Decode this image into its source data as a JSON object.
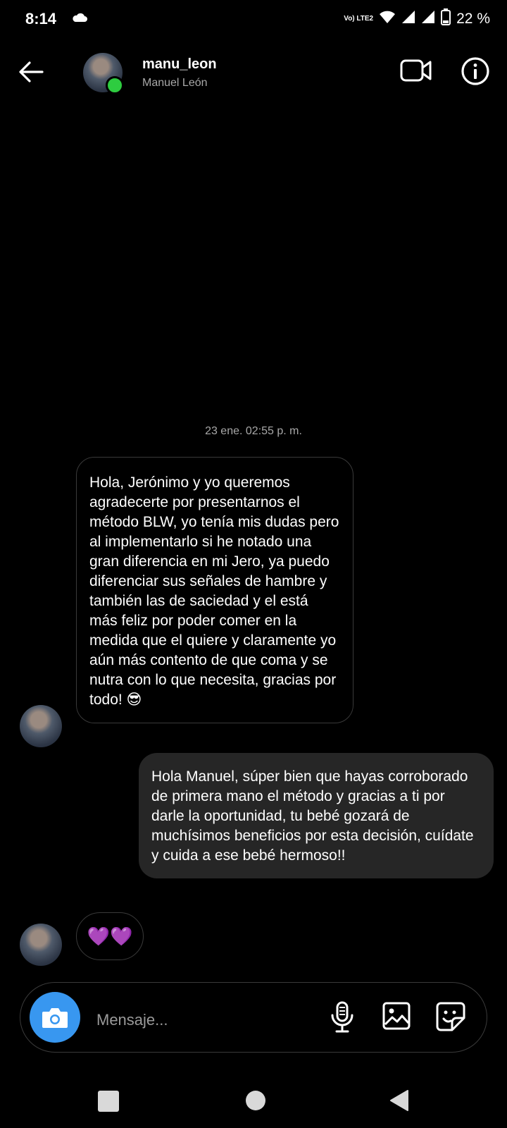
{
  "status_bar": {
    "time": "8:14",
    "network": "Vo) LTE2",
    "battery": "22 %"
  },
  "header": {
    "username": "manu_leon",
    "real_name": "Manuel León"
  },
  "conversation": {
    "timestamp": "23 ene. 02:55 p. m.",
    "incoming_message": "Hola, Jerónimo y yo queremos agradecerte por presentarnos el método BLW, yo tenía mis dudas pero al implementarlo si he notado una gran diferencia en mi Jero, ya puedo diferenciar sus señales de hambre y también las de saciedad y el está más feliz por poder comer en la medida que el quiere y claramente yo aún más contento de que coma y se nutra con lo que necesita, gracias por todo! 😎",
    "outgoing_message": "Hola Manuel, súper bien que hayas corroborado de primera mano el método y gracias a ti por darle la oportunidad, tu bebé gozará de muchísimos beneficios por esta decisión, cuídate y cuida a ese bebé hermoso!!",
    "reaction": "💜💜"
  },
  "composer": {
    "placeholder": "Mensaje..."
  },
  "colors": {
    "accent": "#3897f0",
    "online": "#2ecc40",
    "outgoing_bubble": "#262626"
  },
  "icons": [
    "back-arrow-icon",
    "video-call-icon",
    "info-icon",
    "camera-icon",
    "mic-icon",
    "gallery-icon",
    "sticker-icon"
  ]
}
